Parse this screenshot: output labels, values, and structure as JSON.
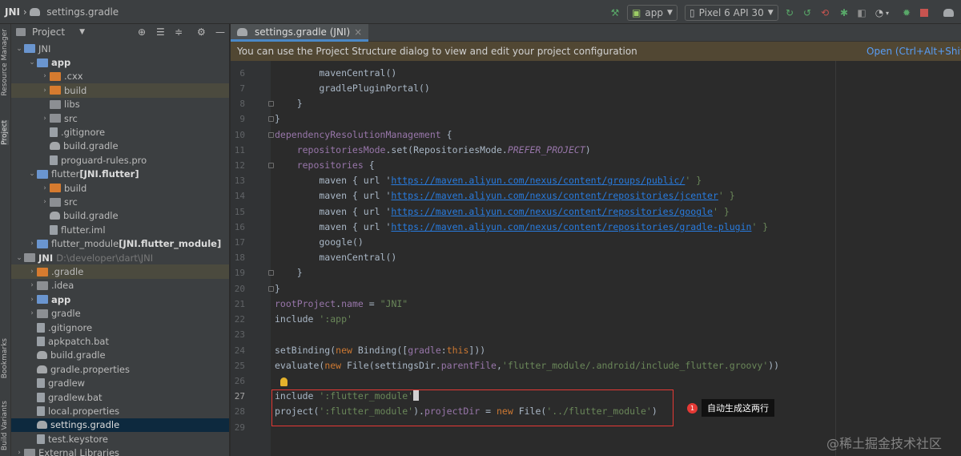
{
  "titlebar": {
    "project": "JNI",
    "file": "settings.gradle",
    "run_config": "app",
    "device": "Pixel 6 API 30"
  },
  "left_strip": {
    "resource_manager": "Resource Manager",
    "project": "Project",
    "bookmarks": "Bookmarks",
    "build_variants": "Build Variants"
  },
  "project_pane": {
    "title": "Project",
    "tree": [
      {
        "label": "JNI",
        "extra": ""
      },
      {
        "label": "app",
        "extra": ""
      },
      {
        "label": ".cxx",
        "extra": ""
      },
      {
        "label": "build",
        "extra": ""
      },
      {
        "label": "libs",
        "extra": ""
      },
      {
        "label": "src",
        "extra": ""
      },
      {
        "label": ".gitignore",
        "extra": ""
      },
      {
        "label": "build.gradle",
        "extra": ""
      },
      {
        "label": "proguard-rules.pro",
        "extra": ""
      },
      {
        "label": "flutter",
        "extra": "[JNI.flutter]"
      },
      {
        "label": "build",
        "extra": ""
      },
      {
        "label": "src",
        "extra": ""
      },
      {
        "label": "build.gradle",
        "extra": ""
      },
      {
        "label": "flutter.iml",
        "extra": ""
      },
      {
        "label": "flutter_module",
        "extra": "[JNI.flutter_module]"
      },
      {
        "label": "JNI",
        "extra": "D:\\developer\\dart\\JNI"
      },
      {
        "label": ".gradle",
        "extra": ""
      },
      {
        "label": ".idea",
        "extra": ""
      },
      {
        "label": "app",
        "extra": ""
      },
      {
        "label": "gradle",
        "extra": ""
      },
      {
        "label": ".gitignore",
        "extra": ""
      },
      {
        "label": "apkpatch.bat",
        "extra": ""
      },
      {
        "label": "build.gradle",
        "extra": ""
      },
      {
        "label": "gradle.properties",
        "extra": ""
      },
      {
        "label": "gradlew",
        "extra": ""
      },
      {
        "label": "gradlew.bat",
        "extra": ""
      },
      {
        "label": "local.properties",
        "extra": ""
      },
      {
        "label": "settings.gradle",
        "extra": ""
      },
      {
        "label": "test.keystore",
        "extra": ""
      },
      {
        "label": "External Libraries",
        "extra": ""
      }
    ]
  },
  "editor": {
    "tab_label": "settings.gradle (JNI)",
    "notice": "You can use the Project Structure dialog to view and edit your project configuration",
    "notice_link": "Open (Ctrl+Alt+Shift+S",
    "line_numbers": [
      "6",
      "7",
      "8",
      "9",
      "10",
      "11",
      "12",
      "13",
      "14",
      "15",
      "16",
      "17",
      "18",
      "19",
      "20",
      "21",
      "22",
      "23",
      "24",
      "25",
      "26",
      "27",
      "28",
      "29"
    ],
    "lines": {
      "l6": "        mavenCentral()",
      "l7": "        gradlePluginPortal()",
      "l8": "    }",
      "l9": "}",
      "l10_a": "dependencyResolutionManagement",
      "l10_b": " {",
      "l11_a": "    repositoriesMode",
      "l11_b": ".set(RepositoriesMode.",
      "l11_c": "PREFER_PROJECT",
      "l11_d": ")",
      "l12_a": "    repositories",
      "l12_b": " {",
      "maven_prefix": "        maven { url '",
      "url13": "https://maven.aliyun.com/nexus/content/groups/public/",
      "url14": "https://maven.aliyun.com/nexus/content/repositories/jcenter",
      "url15": "https://maven.aliyun.com/nexus/content/repositories/google",
      "url16": "https://maven.aliyun.com/nexus/content/repositories/gradle-plugin",
      "maven_suffix": "' }",
      "l17": "        google()",
      "l18": "        mavenCentral()",
      "l19": "    }",
      "l20": "}",
      "l21_a": "rootProject",
      "l21_b": ".",
      "l21_c": "name",
      "l21_d": " = ",
      "l21_e": "\"JNI\"",
      "l22_a": "include ",
      "l22_b": "':app'",
      "l24_a": "setBinding(",
      "l24_b": "new",
      "l24_c": " Binding([",
      "l24_d": "gradle",
      "l24_e": ":",
      "l24_f": "this",
      "l24_g": "]))",
      "l25_a": "evaluate(",
      "l25_b": "new",
      "l25_c": " File(settingsDir.",
      "l25_d": "parentFile",
      "l25_e": ",",
      "l25_f": "'flutter_module/.android/include_flutter.groovy'",
      "l25_g": "))",
      "l27_a": "include ",
      "l27_b": "':flutter_module'",
      "l28_a": "project(",
      "l28_b": "':flutter_module'",
      "l28_c": ").",
      "l28_d": "projectDir",
      "l28_e": " = ",
      "l28_f": "new",
      "l28_g": " File(",
      "l28_h": "'../flutter_module'",
      "l28_i": ")"
    }
  },
  "annotation": {
    "badge": "1",
    "callout": "自动生成这两行"
  },
  "watermark": "@稀土掘金技术社区",
  "colors": {
    "accent": "#4a88c7",
    "annotation_red": "#e53935",
    "string_green": "#6a8759",
    "keyword_orange": "#cc7832"
  }
}
